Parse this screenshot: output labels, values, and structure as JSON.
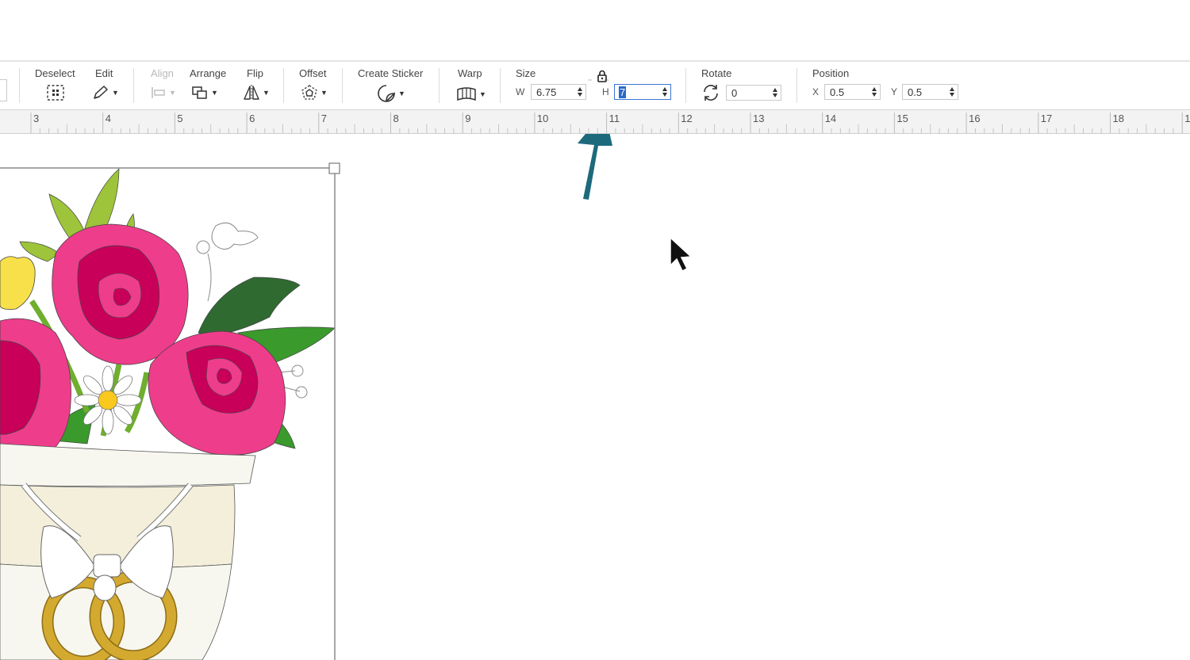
{
  "toolbar": {
    "deselect_label": "Deselect",
    "edit_label": "Edit",
    "align_label": "Align",
    "arrange_label": "Arrange",
    "flip_label": "Flip",
    "offset_label": "Offset",
    "create_sticker_label": "Create Sticker",
    "warp_label": "Warp",
    "size_label": "Size",
    "width_axis": "W",
    "width_value": "6.75",
    "height_axis": "H",
    "height_value": "7",
    "rotate_label": "Rotate",
    "rotate_value": "0",
    "position_label": "Position",
    "x_axis": "X",
    "x_value": "0.5",
    "y_axis": "Y",
    "y_value": "0.5"
  },
  "ruler": {
    "numbers": [
      "3",
      "4",
      "5",
      "6",
      "7",
      "8",
      "9",
      "10",
      "11",
      "12",
      "13",
      "14",
      "15",
      "16",
      "17",
      "18",
      "1"
    ]
  },
  "colors": {
    "arrow": "#1d6a7d",
    "rose": "#ee3d8b",
    "rose_dark": "#c8005a",
    "leaf": "#3a9a2c",
    "leaf_light": "#9dc43a",
    "leaf_dark": "#2f6a31",
    "cup": "#f7f7ef",
    "cup_band": "#f3efdb",
    "rings": "#d4a930",
    "selection": "#7a7a7a"
  },
  "icons": [
    "deselect-icon",
    "pencil-icon",
    "align-icon",
    "arrange-icon",
    "flip-icon",
    "offset-icon",
    "sticker-icon",
    "warp-icon",
    "lock-icon",
    "rotate-icon",
    "spinner-icon",
    "cursor-icon",
    "annotation-arrow"
  ]
}
